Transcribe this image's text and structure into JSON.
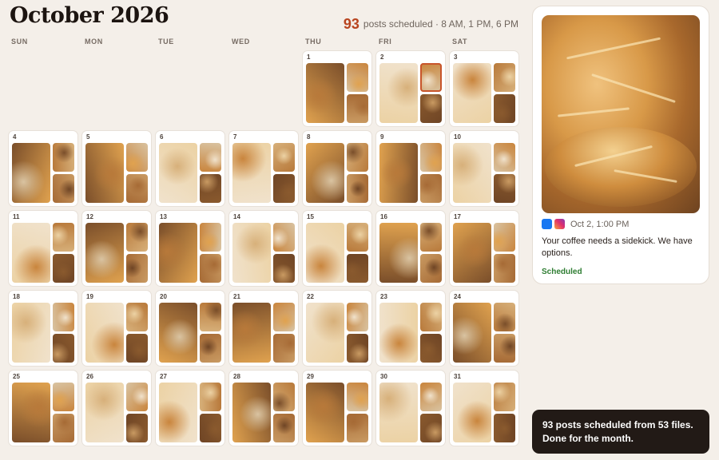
{
  "header": {
    "title": "October 2026",
    "count": "93",
    "summary": "posts scheduled · 8 AM, 1 PM, 6 PM"
  },
  "weekdays": [
    "SUN",
    "MON",
    "TUE",
    "WED",
    "THU",
    "FRI",
    "SAT"
  ],
  "calendar": {
    "leading_blank_days": 4,
    "selected_day": "2",
    "days": [
      "1",
      "2",
      "3",
      "4",
      "5",
      "6",
      "7",
      "8",
      "9",
      "10",
      "11",
      "12",
      "13",
      "14",
      "15",
      "16",
      "17",
      "18",
      "19",
      "20",
      "21",
      "22",
      "23",
      "24",
      "25",
      "26",
      "27",
      "28",
      "29",
      "30",
      "31"
    ]
  },
  "preview": {
    "image": "bread-loaf-photo",
    "networks": [
      "facebook-icon",
      "instagram-icon"
    ],
    "date": "Oct 2, 1:00 PM",
    "caption": "Your coffee needs a sidekick. We have options.",
    "status": "Scheduled"
  },
  "toast": {
    "message": "93 posts scheduled from 53 files. Done for the month."
  },
  "colors": {
    "background": "#f4efe9",
    "accent": "#b8441f",
    "status_green": "#2e7d32",
    "toast_bg": "#221a16",
    "photo_palette": [
      "#c9853d",
      "#e0a24f",
      "#8a5a2e",
      "#d9c3a1",
      "#f0e2cc",
      "#6f4525",
      "#b8793a",
      "#ecd2a4",
      "#a66a35",
      "#d7b07a",
      "#7a4e2a",
      "#c99a62"
    ]
  }
}
